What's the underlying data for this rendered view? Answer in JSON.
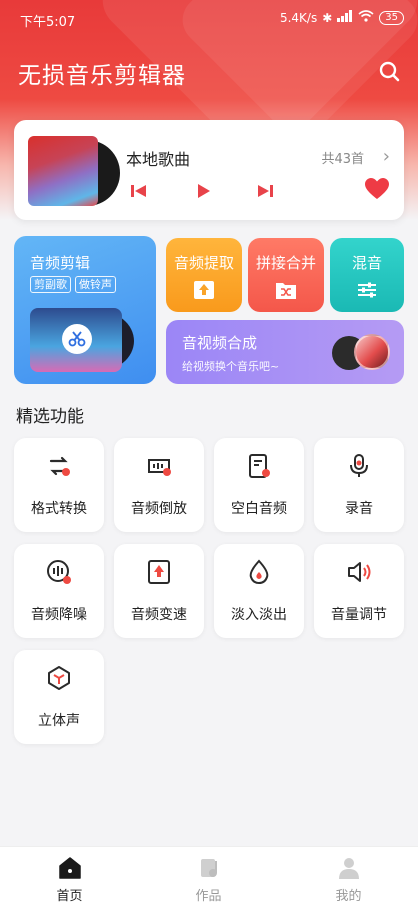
{
  "status_bar": {
    "time": "下午5:07",
    "network_speed": "5.4K/s",
    "battery": "35"
  },
  "header": {
    "title": "无损音乐剪辑器"
  },
  "local_music": {
    "title": "本地歌曲",
    "count": "共43首"
  },
  "tiles": {
    "audio_edit": {
      "title": "音频剪辑",
      "tags": [
        "剪副歌",
        "做铃声"
      ]
    },
    "extract": {
      "title": "音频提取"
    },
    "merge": {
      "title": "拼接合并"
    },
    "mix": {
      "title": "混音"
    },
    "video": {
      "title": "音视频合成",
      "subtitle": "给视频换个音乐吧~"
    }
  },
  "section": {
    "title": "精选功能"
  },
  "features": [
    {
      "label": "格式转换",
      "icon": "format-convert-icon"
    },
    {
      "label": "音频倒放",
      "icon": "reverse-icon"
    },
    {
      "label": "空白音频",
      "icon": "blank-audio-icon"
    },
    {
      "label": "录音",
      "icon": "microphone-icon"
    },
    {
      "label": "音频降噪",
      "icon": "denoise-icon"
    },
    {
      "label": "音频变速",
      "icon": "speed-icon"
    },
    {
      "label": "淡入淡出",
      "icon": "fade-icon"
    },
    {
      "label": "音量调节",
      "icon": "volume-icon"
    },
    {
      "label": "立体声",
      "icon": "stereo-icon"
    }
  ],
  "nav": [
    {
      "label": "首页",
      "icon": "home-icon",
      "active": true
    },
    {
      "label": "作品",
      "icon": "works-icon",
      "active": false
    },
    {
      "label": "我的",
      "icon": "profile-icon",
      "active": false
    }
  ],
  "colors": {
    "brand_red": "#e83a3a",
    "edit_blue": "#4a9cf3",
    "extract_orange": "#f9a42a",
    "merge_red": "#f4574a",
    "mix_teal": "#22c2bd",
    "video_purple": "#a690f5"
  }
}
